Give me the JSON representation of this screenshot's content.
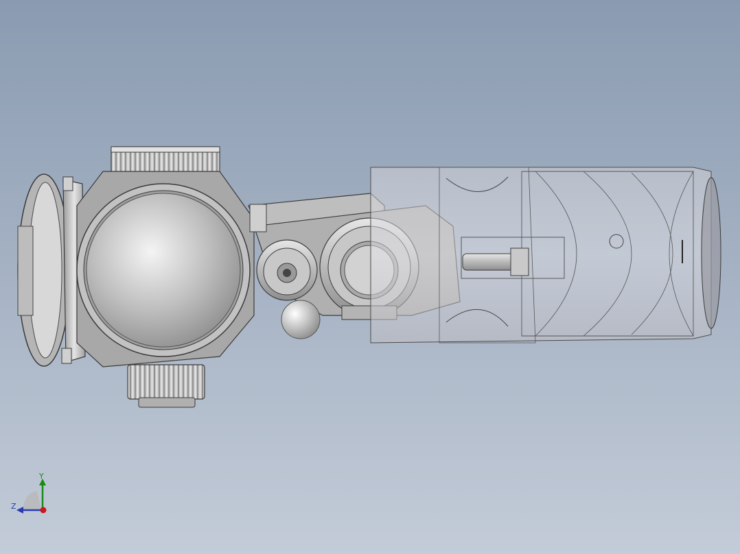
{
  "viewport": {
    "background_top": "#8a9bb1",
    "background_bottom": "#c3ccd8",
    "model": "rifle-scope-assembly"
  },
  "triad": {
    "y_label": "Y",
    "z_label": "Z",
    "y_color": "#1a8a1a",
    "z_color": "#2a3ab0",
    "x_color": "#c81818"
  }
}
